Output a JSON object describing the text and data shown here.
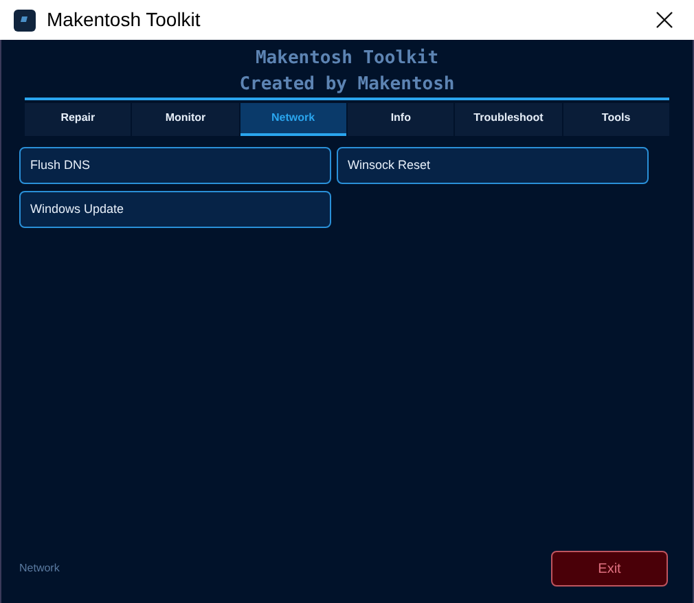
{
  "window": {
    "title": "Makentosh Toolkit"
  },
  "header": {
    "title": "Makentosh Toolkit",
    "subtitle": "Created by Makentosh"
  },
  "tabs": [
    {
      "label": "Repair",
      "selected": false
    },
    {
      "label": "Monitor",
      "selected": false
    },
    {
      "label": "Network",
      "selected": true
    },
    {
      "label": "Info",
      "selected": false
    },
    {
      "label": "Troubleshoot",
      "selected": false
    },
    {
      "label": "Tools",
      "selected": false
    }
  ],
  "actions": [
    "Flush DNS",
    "Winsock Reset",
    "Windows Update"
  ],
  "status_bar": {
    "text": "Network"
  },
  "exit_button": "Exit"
}
